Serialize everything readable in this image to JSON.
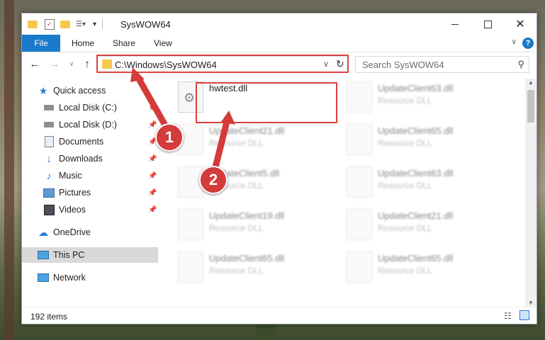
{
  "window": {
    "title": "SysWOW64"
  },
  "ribbon": {
    "file_label": "File",
    "tabs": [
      "Home",
      "Share",
      "View"
    ],
    "help_label": "?"
  },
  "address_bar": {
    "path": "C:\\Windows\\SysWOW64"
  },
  "search": {
    "placeholder": "Search SysWOW64"
  },
  "nav_pane": {
    "quick_access": "Quick access",
    "items": [
      {
        "label": "Local Disk (C:)",
        "icon": "drive-icon",
        "pinned": true
      },
      {
        "label": "Local Disk (D:)",
        "icon": "drive-icon",
        "pinned": true
      },
      {
        "label": "Documents",
        "icon": "documents-icon",
        "pinned": true
      },
      {
        "label": "Downloads",
        "icon": "downloads-icon",
        "pinned": true
      },
      {
        "label": "Music",
        "icon": "music-icon",
        "pinned": true
      },
      {
        "label": "Pictures",
        "icon": "pictures-icon",
        "pinned": true
      },
      {
        "label": "Videos",
        "icon": "videos-icon",
        "pinned": true
      }
    ],
    "onedrive": "OneDrive",
    "this_pc": "This PC",
    "network": "Network"
  },
  "files": [
    {
      "name": "hwtest.dll",
      "desc": ""
    },
    {
      "name": "UpdateClient63.dll",
      "desc": "Resource DLL"
    },
    {
      "name": "UpdateClient21.dll",
      "desc": "Resource DLL"
    },
    {
      "name": "UpdateClient65.dll",
      "desc": "Resource DLL"
    },
    {
      "name": "UpdateClient5.dll",
      "desc": "Resource DLL"
    },
    {
      "name": "UpdateClient63.dll",
      "desc": "Resource DLL"
    },
    {
      "name": "UpdateClient19.dll",
      "desc": "Resource DLL"
    },
    {
      "name": "UpdateClient21.dll",
      "desc": "Resource DLL"
    },
    {
      "name": "UpdateClient65.dll",
      "desc": "Resource DLL"
    },
    {
      "name": "UpdateClient65.dll",
      "desc": "Resource DLL"
    }
  ],
  "status": {
    "item_count": "192 items"
  },
  "callouts": [
    "1",
    "2"
  ],
  "colors": {
    "accent": "#1979ca",
    "highlight": "#d9413f",
    "callout": "#d43b3b"
  }
}
